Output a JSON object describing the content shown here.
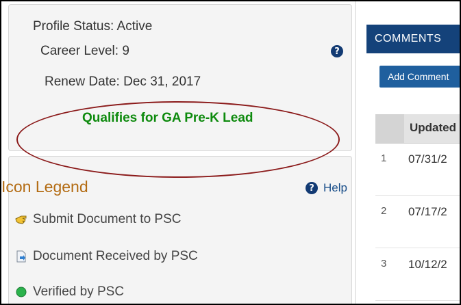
{
  "profile": {
    "status_label": "Profile Status:",
    "status_value": "Active",
    "career_label": "Career Level:",
    "career_value": "9",
    "renew_label": "Renew Date:",
    "renew_value": "Dec 31, 2017",
    "qualifies_text": "Qualifies for GA Pre-K Lead"
  },
  "legend": {
    "title": "Icon Legend",
    "help_label": "Help",
    "items": [
      {
        "label": "Submit Document to PSC",
        "icon": "hand-pointing-icon"
      },
      {
        "label": "Document Received by PSC",
        "icon": "document-received-icon"
      },
      {
        "label": "Verified by PSC",
        "icon": "green-dot-icon"
      }
    ]
  },
  "comments": {
    "header": "COMMENTS",
    "add_button": "Add Comment",
    "column_header": "Updated",
    "rows": [
      {
        "index": "1",
        "date": "07/31/2"
      },
      {
        "index": "2",
        "date": "07/17/2"
      },
      {
        "index": "3",
        "date": "10/12/2"
      }
    ]
  },
  "colors": {
    "qualifies_green": "#0d8a0d",
    "legend_title_orange": "#b36b12",
    "header_navy": "#14427a",
    "ellipse_red": "#8b1a1a"
  }
}
